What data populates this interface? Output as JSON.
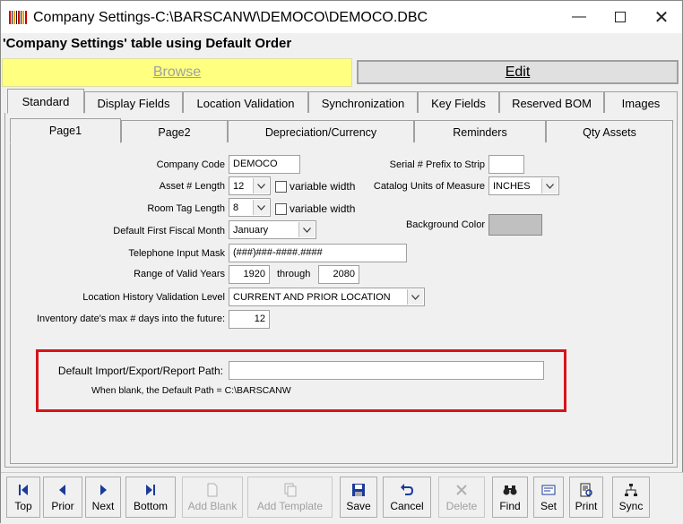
{
  "window": {
    "title": "Company Settings-C:\\BARSCANW\\DEMOCO\\DEMOCO.DBC"
  },
  "header": {
    "caption": "'Company Settings' table using Default Order"
  },
  "modes": {
    "browse": "Browse",
    "edit": "Edit"
  },
  "tabs": [
    "Standard",
    "Display Fields",
    "Location Validation",
    "Synchronization",
    "Key Fields",
    "Reserved BOM",
    "Images"
  ],
  "subtabs": [
    "Page1",
    "Page2",
    "Depreciation/Currency",
    "Reminders",
    "Qty Assets"
  ],
  "form": {
    "company_code_label": "Company Code",
    "company_code": "DEMOCO",
    "asset_length_label": "Asset # Length",
    "asset_length": "12",
    "variable_width_label": "variable width",
    "room_tag_length_label": "Room Tag Length",
    "room_tag_length": "8",
    "fiscal_month_label": "Default First Fiscal Month",
    "fiscal_month": "January",
    "phone_mask_label": "Telephone Input Mask",
    "phone_mask": "(###)###-####.####",
    "valid_years_label": "Range of Valid Years",
    "valid_year_from": "1920",
    "through_label": "through",
    "valid_year_to": "2080",
    "location_history_label": "Location History Validation Level",
    "location_history": "CURRENT AND PRIOR LOCATION",
    "inventory_days_label": "Inventory date's max # days into the future:",
    "inventory_days": "12",
    "serial_prefix_label": "Serial # Prefix to Strip",
    "serial_prefix": "",
    "catalog_units_label": "Catalog Units of Measure",
    "catalog_units": "INCHES",
    "background_color_label": "Background Color",
    "background_color": "#c0c0c0",
    "default_path_label": "Default Import/Export/Report Path:",
    "default_path": "",
    "default_path_note": "When blank, the Default Path = ",
    "default_path_value": "C:\\BARSCANW"
  },
  "toolbar": {
    "top": "Top",
    "prior": "Prior",
    "next": "Next",
    "bottom": "Bottom",
    "add_blank": "Add Blank",
    "add_template": "Add Template",
    "save": "Save",
    "cancel": "Cancel",
    "delete": "Delete",
    "find": "Find",
    "set": "Set",
    "print": "Print",
    "sync": "Sync"
  },
  "colors": {
    "highlight": "#d7141a",
    "browse_bg": "#ffff80"
  }
}
